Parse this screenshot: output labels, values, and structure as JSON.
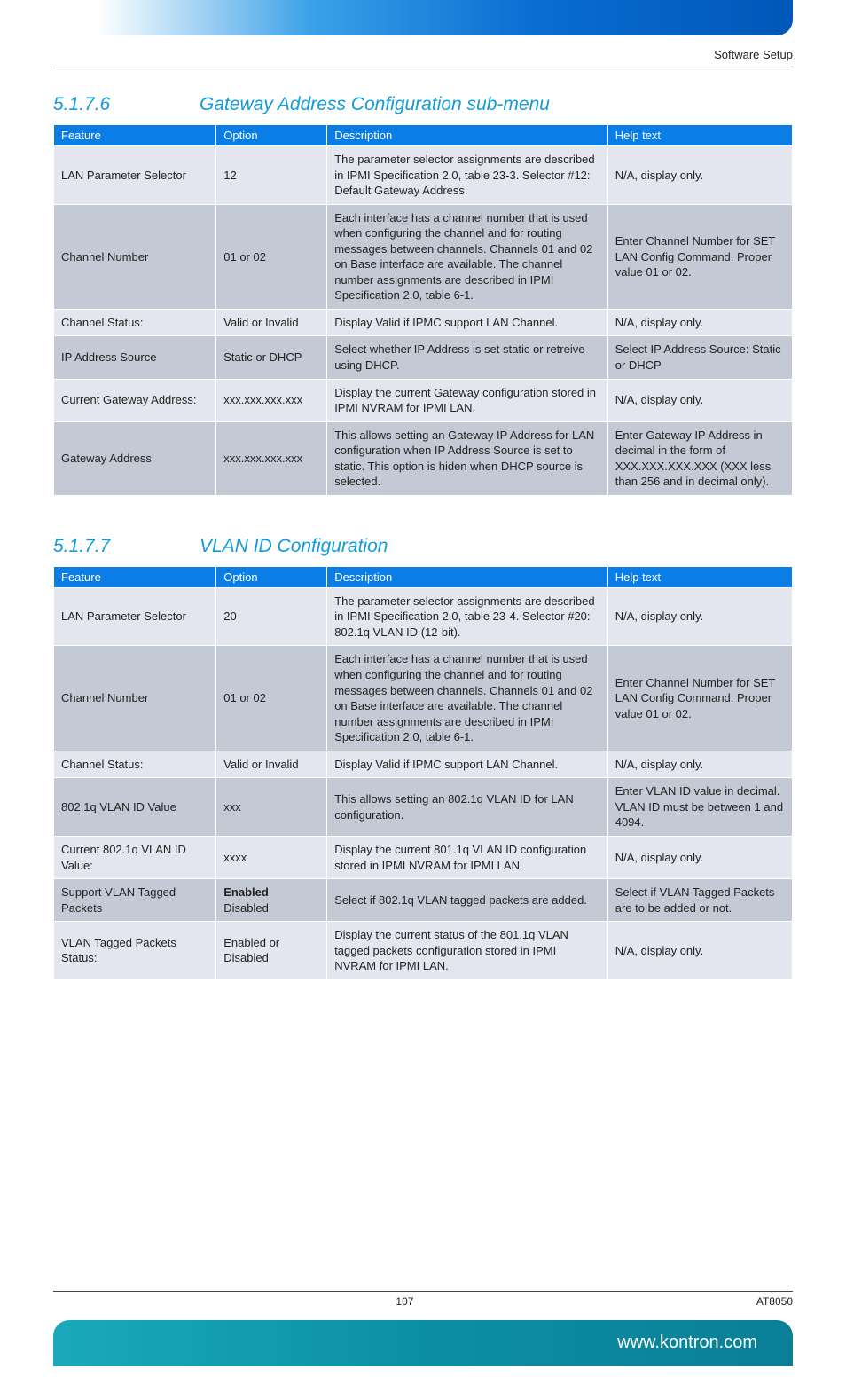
{
  "header": {
    "breadcrumb": "Software Setup"
  },
  "section1": {
    "number": "5.1.7.6",
    "title": "Gateway Address Configuration sub-menu",
    "columns": [
      "Feature",
      "Option",
      "Description",
      "Help text"
    ],
    "rows": [
      {
        "feature": "LAN Parameter Selector",
        "option": "12",
        "description": "The parameter selector assignments are described in IPMI Specification 2.0, table 23-3. Selector #12: Default Gateway Address.",
        "help": "N/A, display only."
      },
      {
        "feature": "Channel Number",
        "option": "01 or 02",
        "description": "Each interface has a channel number that is used when configuring the channel and for routing messages between channels. Channels 01 and 02 on Base interface are available. The channel number assignments are described in IPMI Specification 2.0, table 6-1.",
        "help": "Enter Channel Number for SET LAN Config Command. Proper value 01 or 02."
      },
      {
        "feature": "Channel Status:",
        "option": "Valid or Invalid",
        "description": "Display Valid if IPMC support LAN Channel.",
        "help": "N/A, display only."
      },
      {
        "feature": "IP Address Source",
        "option": "Static or DHCP",
        "description": "Select whether IP Address is set static or retreive using DHCP.",
        "help": "Select IP Address Source: Static or DHCP"
      },
      {
        "feature": "Current Gateway Address:",
        "option": "xxx.xxx.xxx.xxx",
        "description": "Display the current Gateway configuration stored in IPMI NVRAM for IPMI LAN.",
        "help": "N/A, display only."
      },
      {
        "feature": "Gateway Address",
        "option": "xxx.xxx.xxx.xxx",
        "description": "This allows setting an Gateway IP Address for LAN configuration when IP Address Source is set to static. This option is hiden when DHCP source is selected.",
        "help": "Enter Gateway IP Address in decimal in the form of XXX.XXX.XXX.XXX (XXX less than 256 and in decimal only)."
      }
    ]
  },
  "section2": {
    "number": "5.1.7.7",
    "title": "VLAN ID Configuration",
    "columns": [
      "Feature",
      "Option",
      "Description",
      "Help text"
    ],
    "rows": [
      {
        "feature": "LAN Parameter Selector",
        "option": "20",
        "description": "The parameter selector assignments are described in IPMI Specification 2.0, table 23-4. Selector #20: 802.1q VLAN ID (12-bit).",
        "help": "N/A, display only."
      },
      {
        "feature": "Channel Number",
        "option": "01 or 02",
        "description": "Each interface has a channel number that is used when configuring the channel and for routing messages between channels. Channels 01 and 02 on Base interface are available. The channel number assignments are described in IPMI Specification 2.0, table 6-1.",
        "help": "Enter Channel Number for SET LAN Config Command. Proper value 01 or 02."
      },
      {
        "feature": "Channel Status:",
        "option": "Valid or Invalid",
        "description": "Display Valid if IPMC support LAN Channel.",
        "help": "N/A, display only."
      },
      {
        "feature": "802.1q VLAN ID Value",
        "option": "xxx",
        "description": "This allows setting an 802.1q VLAN ID for LAN configuration.",
        "help": "Enter VLAN ID value in decimal. VLAN ID must be between 1 and 4094."
      },
      {
        "feature": "Current 802.1q VLAN ID Value:",
        "option": "xxxx",
        "description": "Display the current 801.1q VLAN ID configuration stored in IPMI NVRAM for IPMI LAN.",
        "help": "N/A, display only."
      },
      {
        "feature": "Support VLAN Tagged Packets",
        "option_enabled": "Enabled",
        "option_disabled": "Disabled",
        "description": "Select if 802.1q VLAN tagged packets are added.",
        "help": "Select if VLAN Tagged Packets are to be added or not."
      },
      {
        "feature": "VLAN Tagged Packets Status:",
        "option": "Enabled or Disabled",
        "description": "Display the current status of the 801.1q VLAN tagged packets configuration stored in IPMI NVRAM for IPMI LAN.",
        "help": "N/A, display only."
      }
    ]
  },
  "footer": {
    "page": "107",
    "model": "AT8050",
    "url": "www.kontron.com"
  }
}
